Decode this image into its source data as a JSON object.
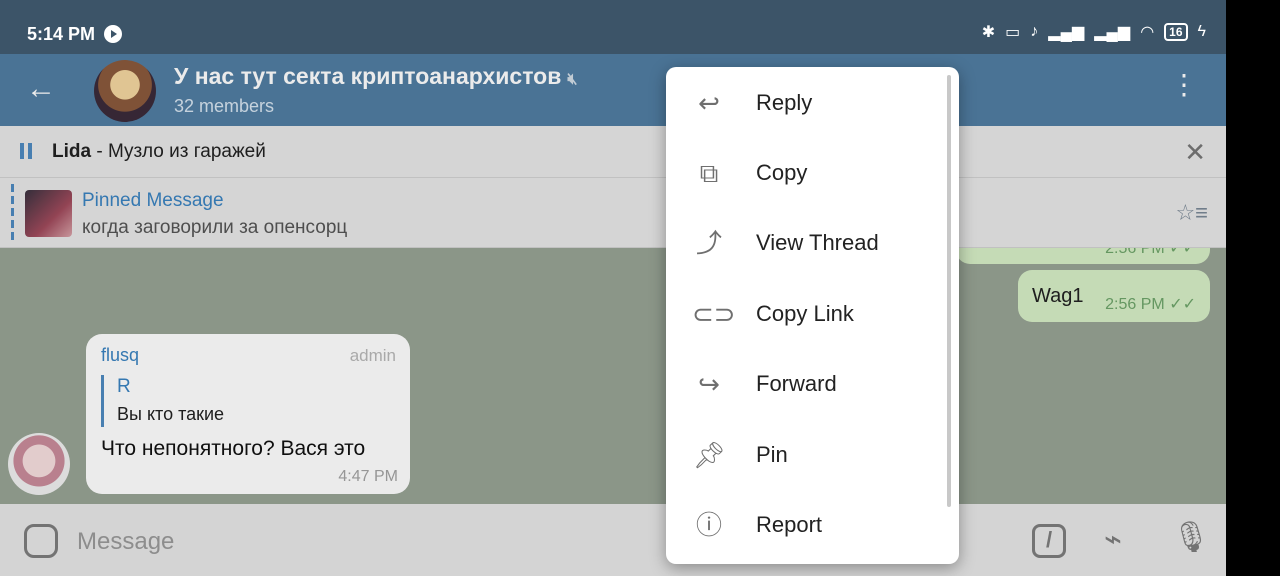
{
  "status_bar": {
    "time": "5:14 PM",
    "battery": "16"
  },
  "header": {
    "title": "У нас тут секта криптоанархистов",
    "subtitle": "32 members"
  },
  "player": {
    "artist": "Lida",
    "track": " - Музло из гаражей"
  },
  "pinned": {
    "title": "Pinned Message",
    "text": "когда заговорили за опенсорц"
  },
  "chat": {
    "outgoing_top": {
      "time": "2:56 PM"
    },
    "outgoing_wag": {
      "text": "Wag1",
      "time": "2:56 PM"
    },
    "incoming": {
      "sender": "flusq",
      "role": "admin",
      "reply_to_name": "R",
      "reply_to_text": "Вы кто такие",
      "text": "Что непонятного? Вася это",
      "time": "4:47 PM"
    }
  },
  "input": {
    "placeholder": "Message"
  },
  "context_menu": {
    "items": [
      {
        "label": "Reply",
        "icon": "reply-icon"
      },
      {
        "label": "Copy",
        "icon": "copy-icon"
      },
      {
        "label": "View Thread",
        "icon": "thread-icon"
      },
      {
        "label": "Copy Link",
        "icon": "link-icon"
      },
      {
        "label": "Forward",
        "icon": "forward-icon"
      },
      {
        "label": "Pin",
        "icon": "pin-icon"
      },
      {
        "label": "Report",
        "icon": "report-icon"
      }
    ]
  },
  "colors": {
    "header": "#517da2",
    "status_bar": "#3c5468",
    "accent": "#3a83c1",
    "outgoing_bubble": "#d6eec6",
    "read_check": "#6ea46a"
  }
}
